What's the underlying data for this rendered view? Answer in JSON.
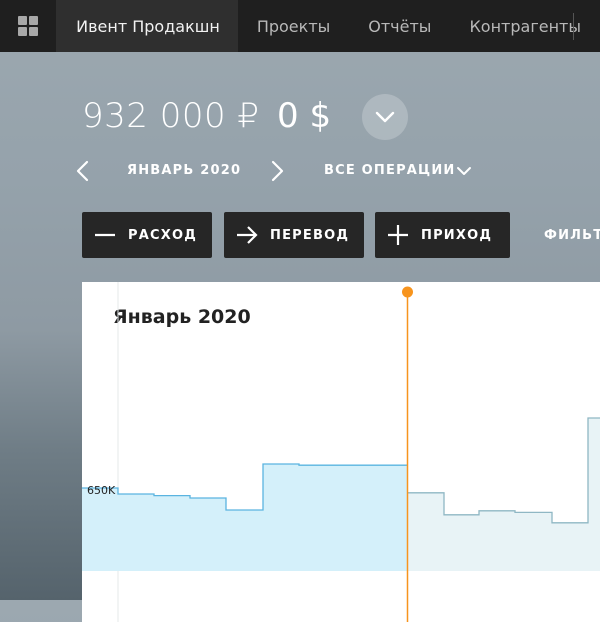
{
  "nav": {
    "menu_icon": "grid-icon",
    "tabs": [
      {
        "label": "Ивент Продакшн",
        "active": true
      },
      {
        "label": "Проекты",
        "active": false
      },
      {
        "label": "Отчёты",
        "active": false
      },
      {
        "label": "Контрагенты",
        "active": false
      }
    ]
  },
  "balance": {
    "rub": "932 000 ₽",
    "usd": "0 $",
    "expand_icon": "chevron-down-icon"
  },
  "period": {
    "prev_icon": "chevron-left-icon",
    "label": "ЯНВАРЬ 2020",
    "next_icon": "chevron-right-icon",
    "operations_label": "ВСЕ ОПЕРАЦИИ",
    "operations_icon": "chevron-down-icon"
  },
  "actions": {
    "expense": {
      "label": "РАСХОД",
      "icon": "minus-icon"
    },
    "transfer": {
      "label": "ПЕРЕВОД",
      "icon": "arrow-right-icon"
    },
    "income": {
      "label": "ПРИХОД",
      "icon": "plus-icon"
    },
    "filter_label": "ФИЛЬТР"
  },
  "colors": {
    "nav_bg": "#1f1f1f",
    "button_bg": "#262626",
    "past_fill": "#d4f0fa",
    "past_line": "#5ab4e0",
    "future_fill": "#e8f3f6",
    "future_line": "#8fb7c4",
    "today_marker": "#f7941d"
  },
  "chart_data": {
    "type": "area",
    "title": "Январь 2020",
    "y_tick_labels": [
      "650K"
    ],
    "today_index": 9,
    "values": [
      655,
      640,
      636,
      630,
      600,
      715,
      712,
      712,
      712,
      643,
      588,
      598,
      594,
      568,
      830
    ]
  }
}
